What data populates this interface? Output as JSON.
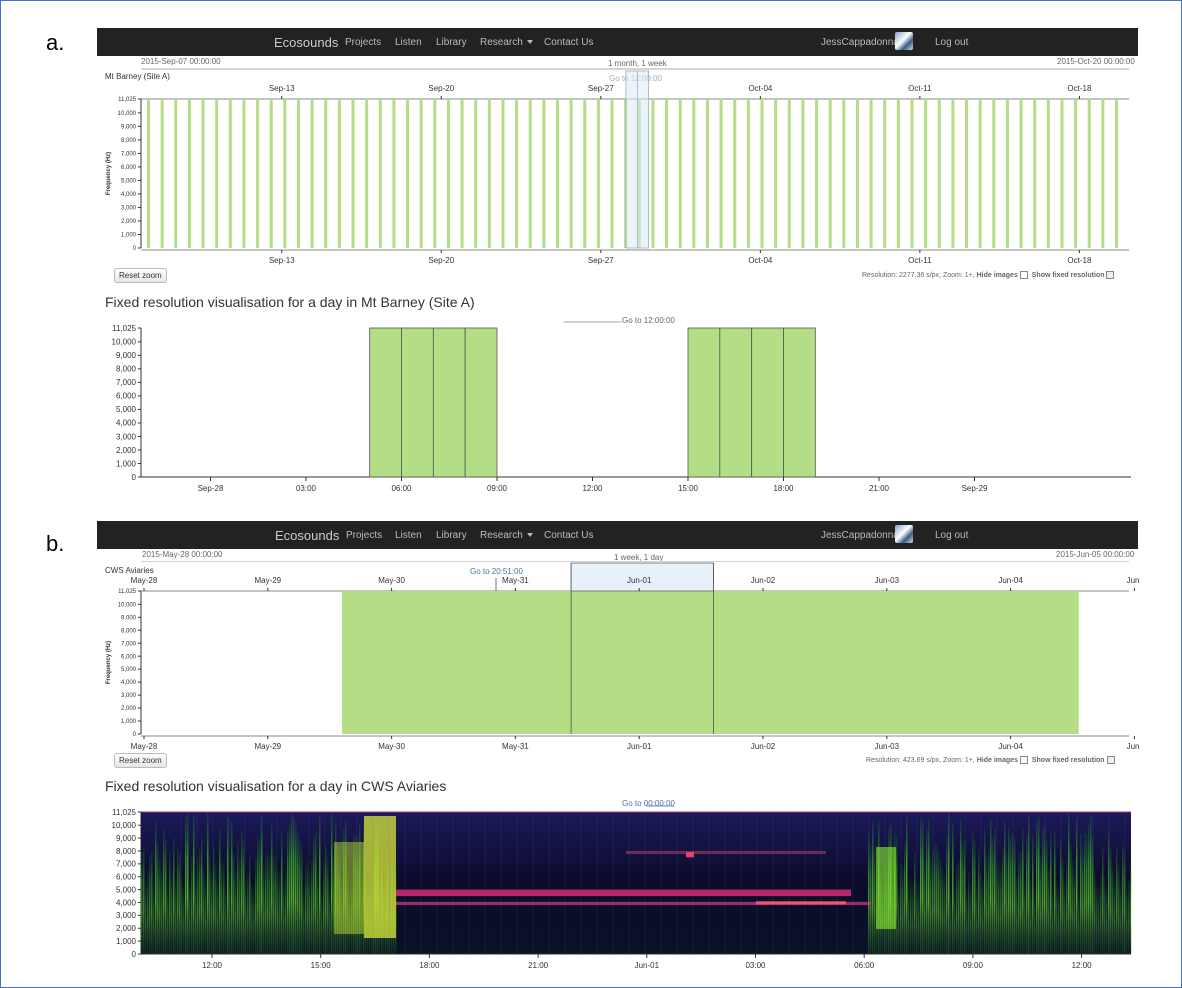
{
  "panels": [
    {
      "letter": "a.",
      "navbar": {
        "brand": "Ecosounds",
        "items": [
          "Projects",
          "Listen",
          "Library",
          "Research",
          "Contact Us"
        ],
        "user": "JessCappadonna",
        "logout": "Log out"
      },
      "range_start": "2015-Sep-07 00:00:00",
      "range_end": "2015-Oct-20 00:00:00",
      "range_span": "1 month, 1 week",
      "site": "Mt Barney (Site A)",
      "goto_label": "Go to 12:00:00",
      "reset_zoom": "Reset zoom",
      "resolution_text": "Resolution: 2277.36 s/px, Zoom: 1+,",
      "hide_images": "Hide images",
      "show_fixed": "Show fixed resolution",
      "fixed_title": "Fixed resolution visualisation for a day in Mt Barney (Site A)",
      "fixed_goto": "Go to 12:00:00"
    },
    {
      "letter": "b.",
      "navbar": {
        "brand": "Ecosounds",
        "items": [
          "Projects",
          "Listen",
          "Library",
          "Research",
          "Contact Us"
        ],
        "user": "JessCappadonna",
        "logout": "Log out"
      },
      "range_start": "2015-May-28 00:00:00",
      "range_end": "2015-Jun-05 00:00:00",
      "range_span": "1 week, 1 day",
      "site": "CWS Aviaries",
      "goto_label": "Go to 20:51:00",
      "reset_zoom": "Reset zoom",
      "resolution_text": "Resolution: 423.69 s/px, Zoom: 1+,",
      "hide_images": "Hide images",
      "show_fixed": "Show fixed resolution",
      "fixed_title": "Fixed resolution visualisation for a day in CWS Aviaries",
      "fixed_goto": "Go to 00:00:00"
    }
  ],
  "chart_data": [
    {
      "type": "bar",
      "title": "",
      "ylabel": "Frequency (Hz)",
      "xlabel": "",
      "x_ticks": [
        "Sep-13",
        "Sep-20",
        "Sep-27",
        "Oct-04",
        "Oct-11",
        "Oct-18"
      ],
      "y_ticks": [
        "11,025",
        "10,000",
        "9,000",
        "8,000",
        "7,000",
        "6,000",
        "5,000",
        "4,000",
        "3,000",
        "2,000",
        "1,000",
        "0"
      ],
      "ylim": [
        0,
        11025
      ],
      "x_range": [
        "2015-09-07",
        "2015-10-20"
      ],
      "recording_days_count": 72,
      "recording_color": "#b3de86",
      "selected_window": [
        "2015-09-28",
        "2015-09-29"
      ]
    },
    {
      "type": "bar",
      "title": "",
      "ylabel": "",
      "xlabel": "",
      "x_ticks": [
        "Sep-28",
        "03:00",
        "06:00",
        "09:00",
        "12:00",
        "15:00",
        "18:00",
        "21:00",
        "Sep-29"
      ],
      "y_ticks": [
        "11,025",
        "10,000",
        "9,000",
        "8,000",
        "7,000",
        "6,000",
        "5,000",
        "4,000",
        "3,000",
        "2,000",
        "1,000",
        "0"
      ],
      "ylim": [
        0,
        11025
      ],
      "recordings_hours": [
        [
          5,
          6
        ],
        [
          6,
          7
        ],
        [
          7,
          8
        ],
        [
          8,
          9
        ],
        [
          15,
          16
        ],
        [
          16,
          17
        ],
        [
          17,
          18
        ],
        [
          18,
          19
        ]
      ],
      "recording_color": "#b3de86"
    },
    {
      "type": "bar",
      "title": "",
      "ylabel": "Frequency (Hz)",
      "xlabel": "",
      "x_ticks": [
        "May-28",
        "May-29",
        "May-30",
        "May-31",
        "Jun-01",
        "Jun-02",
        "Jun-03",
        "Jun-04",
        "Jun-"
      ],
      "y_ticks": [
        "11,025",
        "10,000",
        "9,000",
        "8,000",
        "7,000",
        "6,000",
        "5,000",
        "4,000",
        "3,000",
        "2,000",
        "1,000",
        "0"
      ],
      "ylim": [
        0,
        11025
      ],
      "recording_span_days": [
        1.6,
        7.55
      ],
      "recording_splits_days": [
        3.45,
        4.6
      ],
      "selected_window_days": [
        3.45,
        4.6
      ],
      "recording_color": "#b3de86"
    },
    {
      "type": "heatmap",
      "title": "",
      "ylabel": "",
      "xlabel": "",
      "x_ticks": [
        "12:00",
        "15:00",
        "18:00",
        "21:00",
        "Jun-01",
        "03:00",
        "06:00",
        "09:00",
        "12:00"
      ],
      "y_ticks": [
        "11,025",
        "10,000",
        "9,000",
        "8,000",
        "7,000",
        "6,000",
        "5,000",
        "4,000",
        "3,000",
        "2,000",
        "1,000",
        "0"
      ],
      "ylim": [
        0,
        11025
      ]
    }
  ]
}
